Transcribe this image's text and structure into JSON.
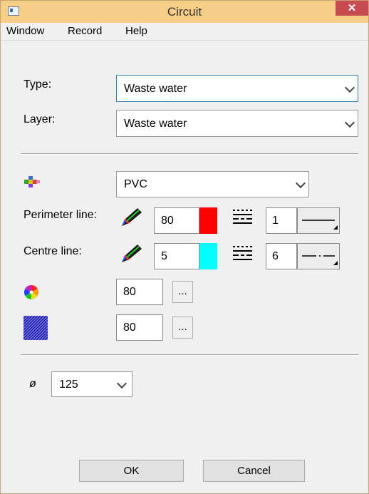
{
  "window": {
    "title": "Circuit",
    "close_glyph": "✕"
  },
  "menu": {
    "items": [
      "Window",
      "Record",
      "Help"
    ]
  },
  "form": {
    "type_label": "Type:",
    "type_value": "Waste water",
    "layer_label": "Layer:",
    "layer_value": "Waste water",
    "material_value": "PVC",
    "perimeter_label": "Perimeter line:",
    "perimeter_width": "80",
    "perimeter_color": "#ff0000",
    "perimeter_style_num": "1",
    "centre_label": "Centre line:",
    "centre_width": "5",
    "centre_color": "#00ffff",
    "centre_style_num": "6",
    "fill_value": "80",
    "hatch_value": "80",
    "browse_label": "...",
    "diameter_symbol": "ø",
    "diameter_value": "125"
  },
  "buttons": {
    "ok": "OK",
    "cancel": "Cancel"
  }
}
